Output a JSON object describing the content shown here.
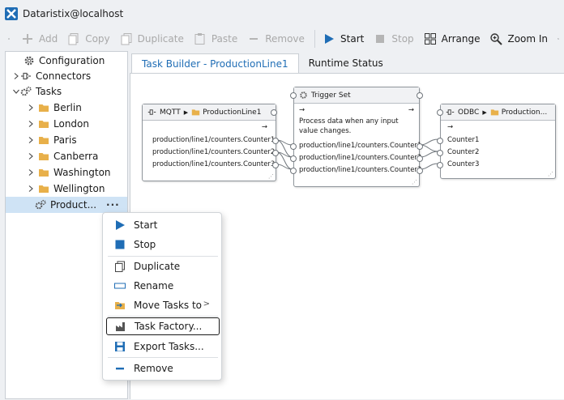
{
  "window": {
    "title": "Dataristix@localhost"
  },
  "toolbar": {
    "add": "Add",
    "copy": "Copy",
    "duplicate": "Duplicate",
    "paste": "Paste",
    "remove": "Remove",
    "start": "Start",
    "stop": "Stop",
    "arrange": "Arrange",
    "zoom_in": "Zoom In"
  },
  "tree": {
    "items": [
      {
        "label": "Configuration"
      },
      {
        "label": "Connectors"
      },
      {
        "label": "Tasks"
      },
      {
        "label": "Berlin"
      },
      {
        "label": "London"
      },
      {
        "label": "Paris"
      },
      {
        "label": "Canberra"
      },
      {
        "label": "Washington"
      },
      {
        "label": "Wellington"
      },
      {
        "label": "Product..."
      }
    ],
    "more": "···"
  },
  "tabs": [
    {
      "label": "Task Builder - ProductionLine1",
      "active": true
    },
    {
      "label": "Runtime Status",
      "active": false
    }
  ],
  "nodes": {
    "mqtt": {
      "type": "MQTT",
      "folder": "ProductionLine1",
      "arrow": "→",
      "rows": [
        "production/line1/counters.Counter1",
        "production/line1/counters.Counter2",
        "production/line1/counters.Counter3"
      ]
    },
    "trigger": {
      "type": "Trigger Set",
      "arrow_in": "→",
      "arrow_out": "→",
      "desc": "Process data when any input value changes.",
      "rows": [
        "production/line1/counters.Counter1",
        "production/line1/counters.Counter2",
        "production/line1/counters.Counter3"
      ]
    },
    "odbc": {
      "type": "ODBC",
      "folder": "Production...",
      "arrow": "→",
      "rows": [
        "Counter1",
        "Counter2",
        "Counter3"
      ]
    }
  },
  "context_menu": {
    "items": [
      {
        "label": "Start"
      },
      {
        "label": "Stop"
      },
      {
        "label": "Duplicate"
      },
      {
        "label": "Rename"
      },
      {
        "label": "Move Tasks to"
      },
      {
        "label": "Task Factory..."
      },
      {
        "label": "Export Tasks..."
      },
      {
        "label": "Remove"
      }
    ]
  },
  "colors": {
    "accent": "#1f6db5",
    "selection": "#cfe3f5",
    "folder": "#e8b04a"
  }
}
